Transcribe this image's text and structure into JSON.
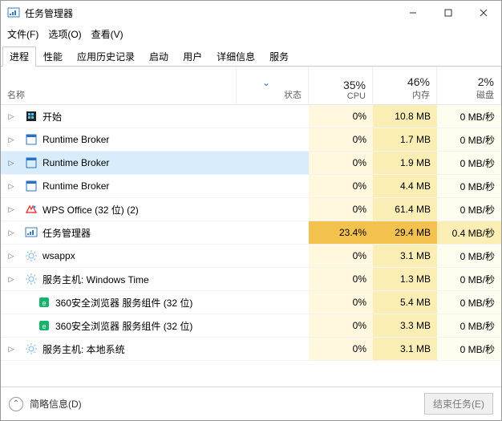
{
  "window": {
    "title": "任务管理器"
  },
  "menu": {
    "file": "文件(F)",
    "options": "选项(O)",
    "view": "查看(V)"
  },
  "tabs": [
    "进程",
    "性能",
    "应用历史记录",
    "启动",
    "用户",
    "详细信息",
    "服务"
  ],
  "activeTab": 0,
  "columns": {
    "name": "名称",
    "status": "状态",
    "cpu": {
      "pct": "35%",
      "label": "CPU"
    },
    "mem": {
      "pct": "46%",
      "label": "内存"
    },
    "disk": {
      "pct": "2%",
      "label": "磁盘"
    }
  },
  "rows": [
    {
      "icon": "start",
      "expandable": true,
      "indent": 0,
      "name": "开始",
      "cpu": "0%",
      "mem": "10.8 MB",
      "disk": "0 MB/秒",
      "selected": false
    },
    {
      "icon": "runtime",
      "expandable": true,
      "indent": 0,
      "name": "Runtime Broker",
      "cpu": "0%",
      "mem": "1.7 MB",
      "disk": "0 MB/秒",
      "selected": false
    },
    {
      "icon": "runtime",
      "expandable": true,
      "indent": 0,
      "name": "Runtime Broker",
      "cpu": "0%",
      "mem": "1.9 MB",
      "disk": "0 MB/秒",
      "selected": true
    },
    {
      "icon": "runtime",
      "expandable": true,
      "indent": 0,
      "name": "Runtime Broker",
      "cpu": "0%",
      "mem": "4.4 MB",
      "disk": "0 MB/秒",
      "selected": false
    },
    {
      "icon": "wps",
      "expandable": true,
      "indent": 0,
      "name": "WPS Office (32 位) (2)",
      "cpu": "0%",
      "mem": "61.4 MB",
      "disk": "0 MB/秒",
      "selected": false
    },
    {
      "icon": "taskmgr",
      "expandable": true,
      "indent": 0,
      "name": "任务管理器",
      "cpu": "23.4%",
      "mem": "29.4 MB",
      "disk": "0.4 MB/秒",
      "selected": false,
      "hot": true
    },
    {
      "icon": "gear",
      "expandable": true,
      "indent": 0,
      "name": "wsappx",
      "cpu": "0%",
      "mem": "3.1 MB",
      "disk": "0 MB/秒",
      "selected": false
    },
    {
      "icon": "gear",
      "expandable": true,
      "indent": 0,
      "name": "服务主机: Windows Time",
      "cpu": "0%",
      "mem": "1.3 MB",
      "disk": "0 MB/秒",
      "selected": false
    },
    {
      "icon": "360",
      "expandable": false,
      "indent": 1,
      "name": "360安全浏览器 服务组件 (32 位)",
      "cpu": "0%",
      "mem": "5.4 MB",
      "disk": "0 MB/秒",
      "selected": false
    },
    {
      "icon": "360",
      "expandable": false,
      "indent": 1,
      "name": "360安全浏览器 服务组件 (32 位)",
      "cpu": "0%",
      "mem": "3.3 MB",
      "disk": "0 MB/秒",
      "selected": false
    },
    {
      "icon": "gear",
      "expandable": true,
      "indent": 0,
      "name": "服务主机: 本地系统",
      "cpu": "0%",
      "mem": "3.1 MB",
      "disk": "0 MB/秒",
      "selected": false
    }
  ],
  "footer": {
    "briefing": "简略信息(D)",
    "endTask": "结束任务(E)"
  },
  "icons": {
    "start": "start-tile-icon",
    "runtime": "app-frame-icon",
    "wps": "wps-office-icon",
    "taskmgr": "task-manager-icon",
    "gear": "gear-service-icon",
    "360": "360-browser-icon"
  }
}
